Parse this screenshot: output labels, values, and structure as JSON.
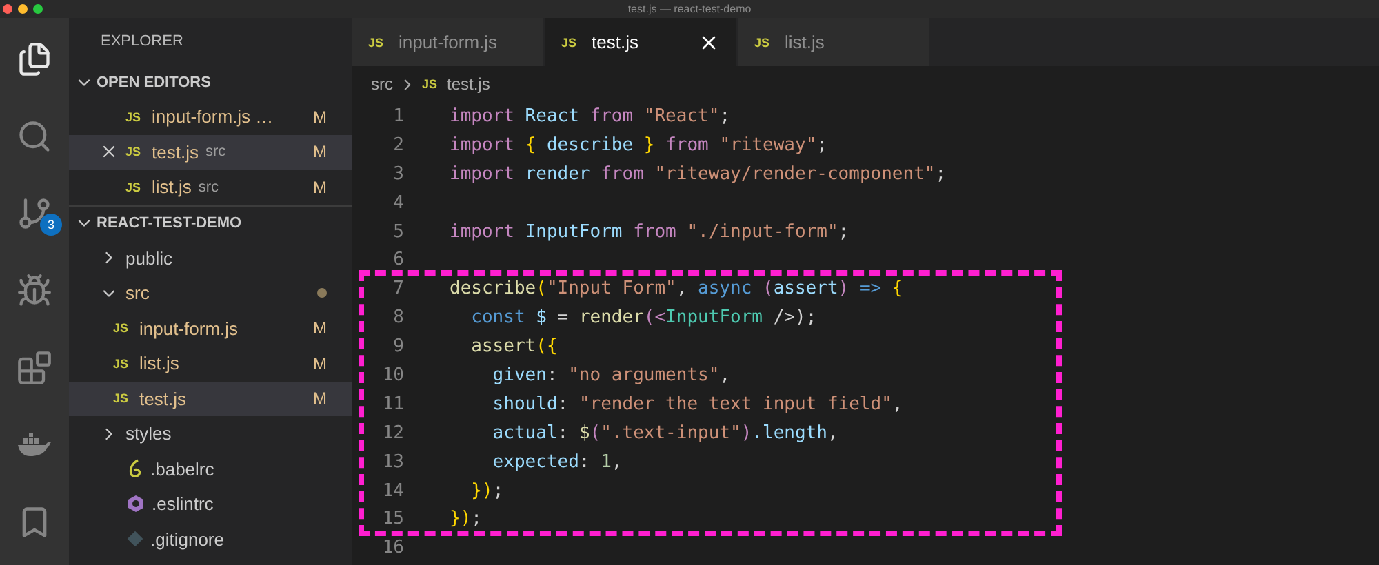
{
  "window": {
    "title": "test.js — react-test-demo"
  },
  "activity_bar": {
    "items": [
      {
        "kind": "files",
        "selected": true
      },
      {
        "kind": "search",
        "selected": false
      },
      {
        "kind": "source-control",
        "selected": false,
        "badge": "3"
      },
      {
        "kind": "run",
        "selected": false
      },
      {
        "kind": "extensions",
        "selected": false
      },
      {
        "kind": "docker",
        "selected": false
      },
      {
        "kind": "bookmark",
        "selected": false
      }
    ]
  },
  "sidebar": {
    "title": "EXPLORER",
    "open_editors": {
      "title": "OPEN EDITORS",
      "expanded": true,
      "items": [
        {
          "icon": "JS",
          "name": "input-form.js …",
          "status": "M",
          "selected": false
        },
        {
          "icon": "JS",
          "name": "test.js",
          "description": "src",
          "status": "M",
          "selected": true
        },
        {
          "icon": "JS",
          "name": "list.js",
          "description": "src",
          "status": "M",
          "selected": false
        }
      ]
    },
    "project": {
      "title": "REACT-TEST-DEMO",
      "expanded": true,
      "items": [
        {
          "name": "public",
          "kind": "folder",
          "expanded": false
        },
        {
          "name": "src",
          "kind": "folder",
          "expanded": true,
          "modified": true,
          "children": [
            {
              "icon": "JS",
              "name": "input-form.js",
              "kind": "js",
              "status": "M",
              "selected": false
            },
            {
              "icon": "JS",
              "name": "list.js",
              "kind": "js",
              "status": "M",
              "selected": false
            },
            {
              "icon": "JS",
              "name": "test.js",
              "kind": "js",
              "status": "M",
              "selected": true
            }
          ]
        },
        {
          "name": "styles",
          "kind": "folder",
          "expanded": false
        },
        {
          "name": ".babelrc",
          "kind": "babel"
        },
        {
          "name": ".eslintrc",
          "kind": "eslint"
        },
        {
          "name": ".gitignore",
          "kind": "git"
        }
      ]
    }
  },
  "tabs": [
    {
      "icon": "JS",
      "label": "input-form.js",
      "selected": false
    },
    {
      "icon": "JS",
      "label": "test.js",
      "selected": true
    },
    {
      "icon": "JS",
      "label": "list.js",
      "selected": false
    }
  ],
  "breadcrumb": [
    {
      "label": "src"
    },
    {
      "icon": "JS",
      "label": "test.js"
    }
  ],
  "code": [
    {
      "n": "1",
      "tokens": [
        {
          "text": "import",
          "kind": "kw"
        },
        {
          "text": " React ",
          "kind": "id"
        },
        {
          "text": "from",
          "kind": "kw"
        },
        {
          "text": " \"React\"",
          "kind": "str"
        },
        {
          "text": ";",
          "kind": "p"
        }
      ]
    },
    {
      "n": "2",
      "tokens": [
        {
          "text": "import",
          "kind": "kw"
        },
        {
          "text": " { ",
          "kind": "br"
        },
        {
          "text": "describe",
          "kind": "id"
        },
        {
          "text": " } ",
          "kind": "br"
        },
        {
          "text": "from",
          "kind": "kw"
        },
        {
          "text": " \"riteway\"",
          "kind": "str"
        },
        {
          "text": ";",
          "kind": "p"
        }
      ]
    },
    {
      "n": "3",
      "tokens": [
        {
          "text": "import",
          "kind": "kw"
        },
        {
          "text": " render ",
          "kind": "id"
        },
        {
          "text": "from",
          "kind": "kw"
        },
        {
          "text": " \"riteway/render-component\"",
          "kind": "str"
        },
        {
          "text": ";",
          "kind": "p"
        }
      ]
    },
    {
      "n": "4"
    },
    {
      "n": "5",
      "tokens": [
        {
          "text": "import",
          "kind": "kw"
        },
        {
          "text": " InputForm ",
          "kind": "id"
        },
        {
          "text": "from",
          "kind": "kw"
        },
        {
          "text": " \"./input-form\"",
          "kind": "str"
        },
        {
          "text": ";",
          "kind": "p"
        }
      ]
    },
    {
      "n": "6"
    },
    {
      "n": "7",
      "tokens": [
        {
          "text": "describe",
          "kind": "fn"
        },
        {
          "text": "(",
          "kind": "br"
        },
        {
          "text": "\"Input Form\"",
          "kind": "str"
        },
        {
          "text": ", ",
          "kind": "p"
        },
        {
          "text": "async",
          "kind": "st"
        },
        {
          "text": " (",
          "kind": "kw"
        },
        {
          "text": "assert",
          "kind": "id"
        },
        {
          "text": ") ",
          "kind": "kw"
        },
        {
          "text": "=>",
          "kind": "st"
        },
        {
          "text": " {",
          "kind": "br"
        }
      ]
    },
    {
      "n": "8",
      "tokens": [
        {
          "text": "  const",
          "kind": "st"
        },
        {
          "text": " $ ",
          "kind": "id"
        },
        {
          "text": "= ",
          "kind": "p"
        },
        {
          "text": "render",
          "kind": "fn"
        },
        {
          "text": "(<",
          "kind": "kw"
        },
        {
          "text": "InputForm",
          "kind": "tag"
        },
        {
          "text": " />)",
          "kind": "p"
        },
        {
          "text": ";",
          "kind": "p"
        }
      ]
    },
    {
      "n": "9",
      "tokens": [
        {
          "text": "  assert",
          "kind": "fn"
        },
        {
          "text": "({",
          "kind": "br"
        }
      ]
    },
    {
      "n": "10",
      "tokens": [
        {
          "text": "    given",
          "kind": "id"
        },
        {
          "text": ": ",
          "kind": "p"
        },
        {
          "text": "\"no arguments\"",
          "kind": "str"
        },
        {
          "text": ",",
          "kind": "p"
        }
      ]
    },
    {
      "n": "11",
      "tokens": [
        {
          "text": "    should",
          "kind": "id"
        },
        {
          "text": ": ",
          "kind": "p"
        },
        {
          "text": "\"render the text input field\"",
          "kind": "str"
        },
        {
          "text": ",",
          "kind": "p"
        }
      ]
    },
    {
      "n": "12",
      "tokens": [
        {
          "text": "    actual",
          "kind": "id"
        },
        {
          "text": ": ",
          "kind": "p"
        },
        {
          "text": "$",
          "kind": "fn"
        },
        {
          "text": "(",
          "kind": "kw"
        },
        {
          "text": "\".text-input\"",
          "kind": "str"
        },
        {
          "text": ")",
          "kind": "kw"
        },
        {
          "text": ".length",
          "kind": "id"
        },
        {
          "text": ",",
          "kind": "p"
        }
      ]
    },
    {
      "n": "13",
      "tokens": [
        {
          "text": "    expected",
          "kind": "id"
        },
        {
          "text": ": ",
          "kind": "p"
        },
        {
          "text": "1",
          "kind": "num"
        },
        {
          "text": ",",
          "kind": "p"
        }
      ]
    },
    {
      "n": "14",
      "tokens": [
        {
          "text": "  })",
          "kind": "br"
        },
        {
          "text": ";",
          "kind": "p"
        }
      ]
    },
    {
      "n": "15",
      "tokens": [
        {
          "text": "})",
          "kind": "br"
        },
        {
          "text": ";",
          "kind": "p"
        }
      ]
    },
    {
      "n": "16"
    }
  ]
}
